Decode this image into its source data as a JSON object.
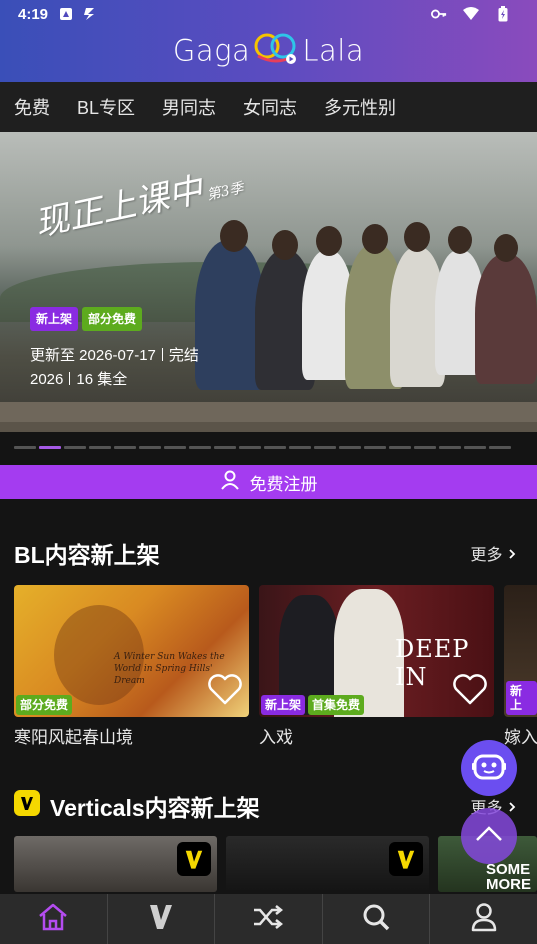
{
  "statusbar": {
    "time": "4:19"
  },
  "app": {
    "logo_left": "Gaga",
    "logo_right": "Lala"
  },
  "tabs": [
    {
      "label": "免费"
    },
    {
      "label": "BL专区"
    },
    {
      "label": "男同志"
    },
    {
      "label": "女同志"
    },
    {
      "label": "多元性别"
    }
  ],
  "hero": {
    "title": "现正上课中",
    "title_sub": "第3季",
    "badges": [
      "新上架",
      "部分免费"
    ],
    "update": "更新至 2026-07-17",
    "status": "完结",
    "year": "2026",
    "episodes": "16 集全",
    "carousel_total": 20,
    "carousel_active": 1
  },
  "register": {
    "label": "免费注册"
  },
  "section_bl": {
    "title": "BL内容新上架",
    "more": "更多",
    "items": [
      {
        "title": "寒阳风起春山境",
        "badges": [
          "部分免费"
        ],
        "poster_text": "A Winter Sun Wakes the World in Spring Hills' Dream"
      },
      {
        "title": "入戏",
        "badges": [
          "新上架",
          "首集免费"
        ],
        "poster_text": "DEEP IN"
      },
      {
        "title": "嫁入",
        "badges": [
          "新上"
        ]
      }
    ]
  },
  "section_verticals": {
    "title": "Verticals内容新上架",
    "more": "更多",
    "poster_text": "SOME MORE"
  },
  "bottom_nav": [
    {
      "icon": "home-icon"
    },
    {
      "icon": "verticals-icon"
    },
    {
      "icon": "shuffle-icon"
    },
    {
      "icon": "search-icon"
    },
    {
      "icon": "profile-icon"
    }
  ],
  "colors": {
    "accent": "#a43cf0",
    "badge_purple": "#8a2be2",
    "badge_green": "#5dab1e"
  }
}
